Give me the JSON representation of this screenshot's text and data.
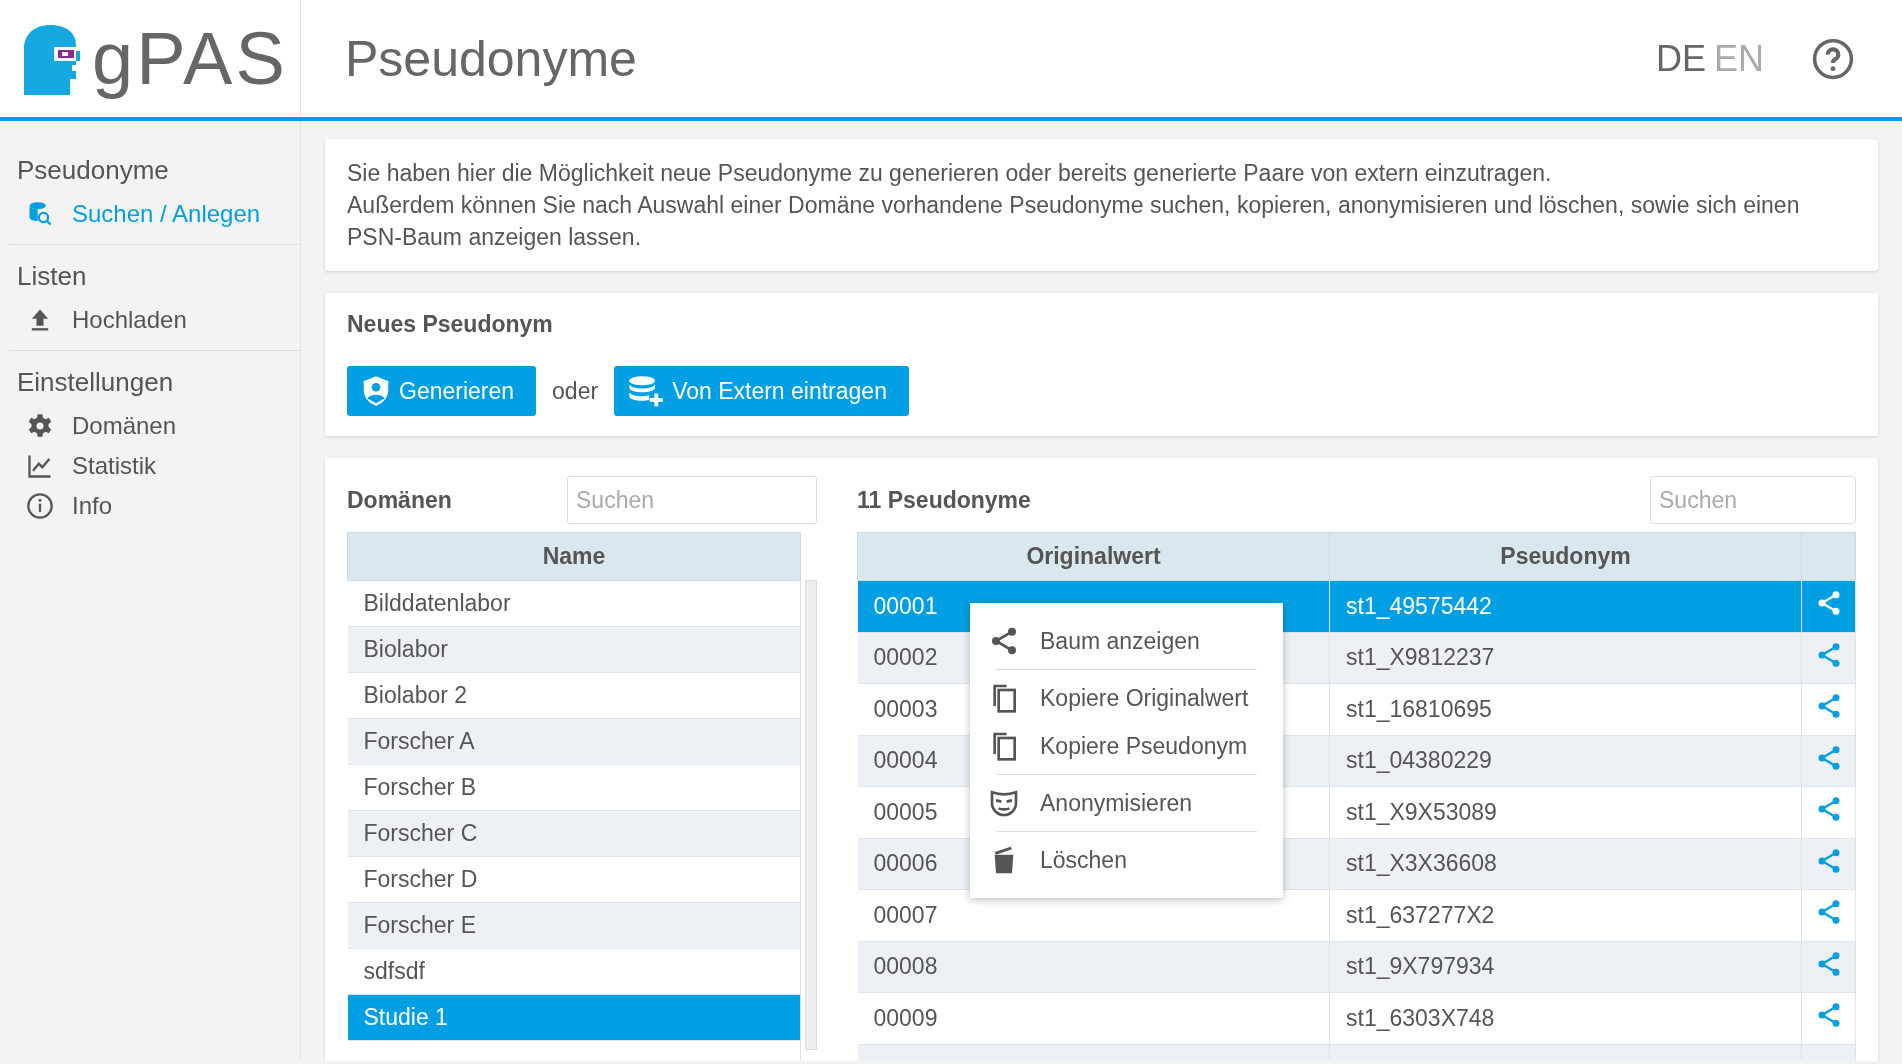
{
  "header": {
    "logo_text": "gPAS",
    "title": "Pseudonyme",
    "languages": [
      {
        "label": "DE",
        "selected": true
      },
      {
        "label": "EN",
        "selected": false
      }
    ]
  },
  "sidebar": {
    "sections": [
      {
        "title": "Pseudonyme",
        "items": [
          {
            "label": "Suchen / Anlegen",
            "kind": "search",
            "selected": true
          }
        ]
      },
      {
        "title": "Listen",
        "items": [
          {
            "label": "Hochladen",
            "kind": "upload",
            "selected": false
          }
        ]
      },
      {
        "title": "Einstellungen",
        "items": [
          {
            "label": "Domänen",
            "kind": "settings",
            "selected": false
          },
          {
            "label": "Statistik",
            "kind": "chart",
            "selected": false
          },
          {
            "label": "Info",
            "kind": "info",
            "selected": false
          }
        ]
      }
    ]
  },
  "intro": {
    "lines": [
      "Sie haben hier die Möglichkeit neue Pseudonyme zu generieren oder bereits generierte Paare von extern einzutragen.",
      "Außerdem können Sie nach Auswahl einer Domäne vorhandene Pseudonyme suchen, kopieren, anonymisieren und löschen, sowie sich einen PSN-Baum anzeigen lassen."
    ]
  },
  "new_pseudonym": {
    "title": "Neues Pseudonym",
    "generate_button": "Generieren",
    "separator": "oder",
    "external_button": "Von Extern eintragen"
  },
  "domains": {
    "title": "Domänen",
    "search": {
      "placeholder": "Suchen"
    },
    "column": "Name",
    "rows": [
      {
        "name": "Bilddatenlabor",
        "selected": false
      },
      {
        "name": "Biolabor",
        "selected": false
      },
      {
        "name": "Biolabor 2",
        "selected": false
      },
      {
        "name": "Forscher A",
        "selected": false
      },
      {
        "name": "Forscher B",
        "selected": false
      },
      {
        "name": "Forscher C",
        "selected": false
      },
      {
        "name": "Forscher D",
        "selected": false
      },
      {
        "name": "Forscher E",
        "selected": false
      },
      {
        "name": "sdfsdf",
        "selected": false
      },
      {
        "name": "Studie 1",
        "selected": true
      }
    ]
  },
  "pseudonyms": {
    "title": "11 Pseudonyme",
    "search": {
      "placeholder": "Suchen"
    },
    "columns": [
      "Originalwert",
      "Pseudonym"
    ],
    "rows": [
      {
        "original": "00001",
        "pseudonym": "st1_49575442",
        "selected": true
      },
      {
        "original": "00002",
        "pseudonym": "st1_X9812237",
        "selected": false
      },
      {
        "original": "00003",
        "pseudonym": "st1_16810695",
        "selected": false
      },
      {
        "original": "00004",
        "pseudonym": "st1_04380229",
        "selected": false
      },
      {
        "original": "00005",
        "pseudonym": "st1_X9X53089",
        "selected": false
      },
      {
        "original": "00006",
        "pseudonym": "st1_X3X36608",
        "selected": false
      },
      {
        "original": "00007",
        "pseudonym": "st1_637277X2",
        "selected": false
      },
      {
        "original": "00008",
        "pseudonym": "st1_9X797934",
        "selected": false
      },
      {
        "original": "00009",
        "pseudonym": "st1_6303X748",
        "selected": false
      }
    ]
  },
  "context_menu": {
    "groups": [
      [
        {
          "label": "Baum anzeigen",
          "kind": "tree"
        }
      ],
      [
        {
          "label": "Kopiere Originalwert",
          "kind": "copy"
        },
        {
          "label": "Kopiere Pseudonym",
          "kind": "copy"
        }
      ],
      [
        {
          "label": "Anonymisieren",
          "kind": "mask"
        }
      ],
      [
        {
          "label": "Löschen",
          "kind": "delete"
        }
      ]
    ]
  }
}
